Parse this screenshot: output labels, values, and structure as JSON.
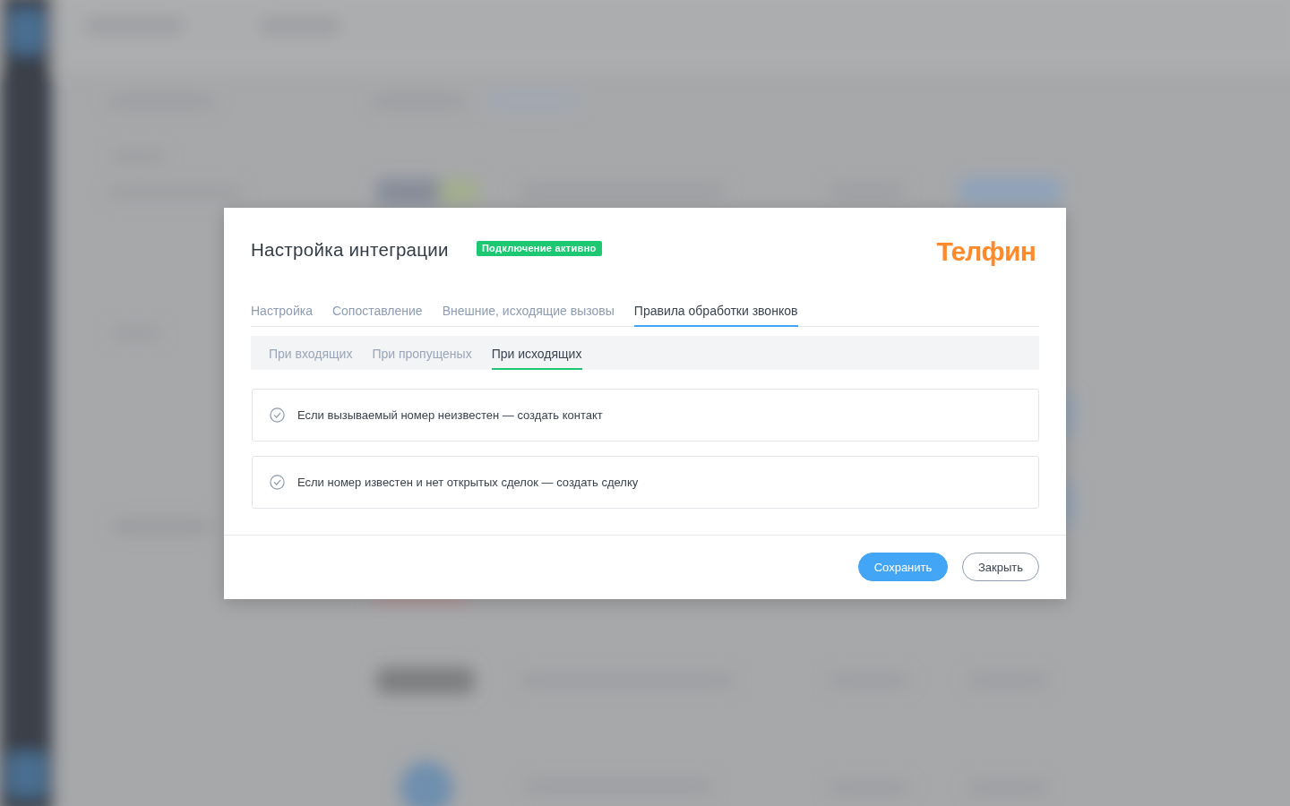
{
  "dialog": {
    "title": "Настройка интеграции",
    "status_badge": "Подключение активно",
    "logo": "Телфин",
    "tabs": [
      {
        "label": "Настройка",
        "selected": false
      },
      {
        "label": "Сопоставление",
        "selected": false
      },
      {
        "label": "Внешние, исходящие вызовы",
        "selected": false
      },
      {
        "label": "Правила обработки звонков",
        "selected": true
      }
    ],
    "subtabs": [
      {
        "label": "При входящих",
        "selected": false
      },
      {
        "label": "При пропущеных",
        "selected": false
      },
      {
        "label": "При исходящих",
        "selected": true
      }
    ],
    "rules": [
      {
        "text": "Если вызываемый номер неизвестен — создать контакт"
      },
      {
        "text": "Если номер известен и нет открытых сделок — создать сделку"
      }
    ],
    "buttons": [
      {
        "label": "Сохранить",
        "kind": "primary"
      },
      {
        "label": "Закрыть",
        "kind": "secondary"
      }
    ]
  }
}
